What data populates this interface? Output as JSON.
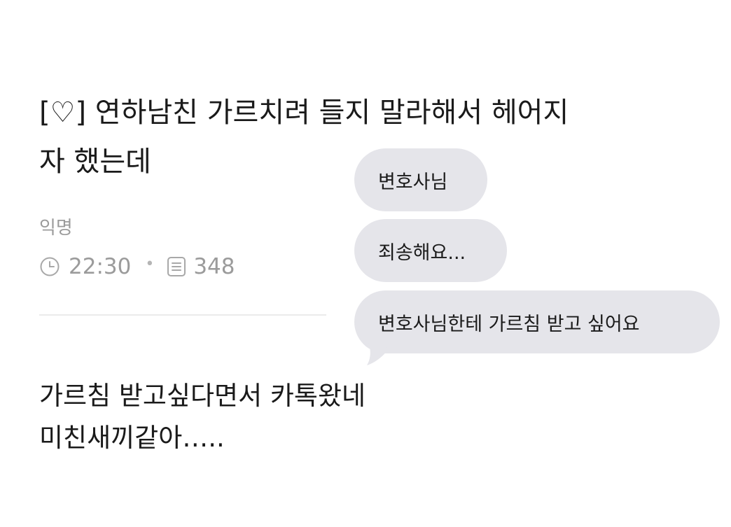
{
  "post": {
    "title_line1": "[♡] 연하남친 가르치려 들지 말라해서 헤어지",
    "title_line2": "자 했는데",
    "author": "익명",
    "time": "22:30",
    "views": "348",
    "icons": {
      "time": "clock-icon",
      "views": "document-icon"
    },
    "body_line1": "가르침 받고싶다면서 카톡왔네",
    "body_line2": "미친새끼같아…..",
    "colors": {
      "meta": "#9b9b9b",
      "divider": "#ebebeb"
    }
  },
  "chat": {
    "messages": [
      {
        "text": "변호사님"
      },
      {
        "text": "죄송해요..."
      },
      {
        "text": "변호사님한테 가르침 받고 싶어요"
      }
    ],
    "bubble_color": "#e5e5ea"
  }
}
